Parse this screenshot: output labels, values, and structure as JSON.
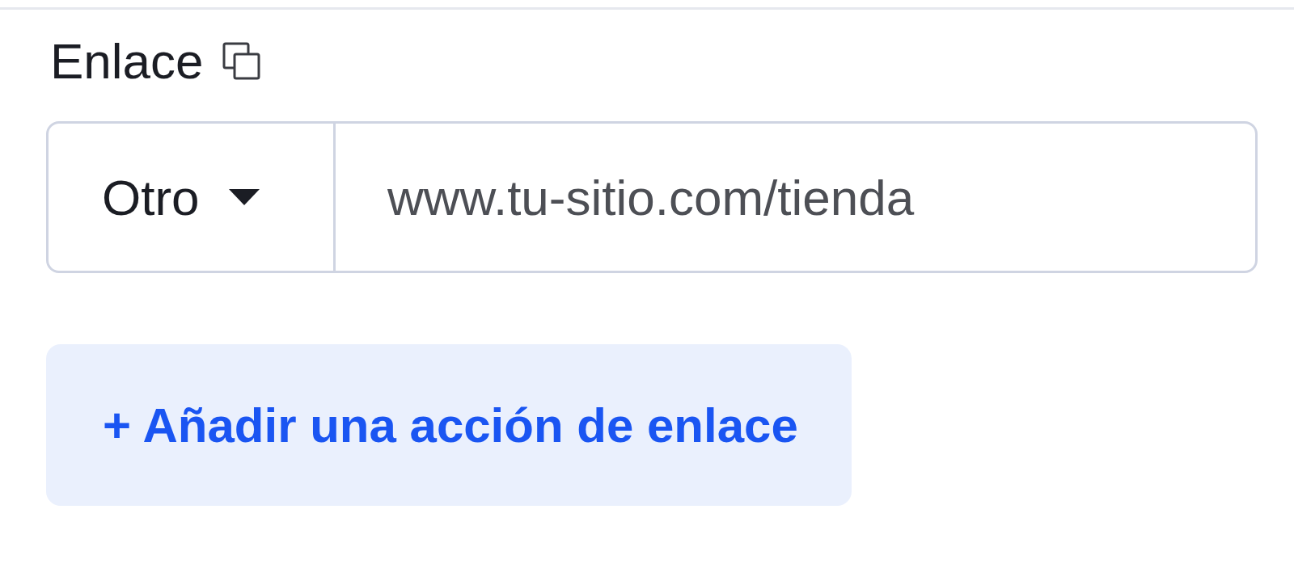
{
  "link_section": {
    "label": "Enlace",
    "link_field": {
      "type_select": "Otro",
      "placeholder": "www.tu-sitio.com/tienda"
    },
    "add_button": "+ Añadir una acción de enlace"
  }
}
